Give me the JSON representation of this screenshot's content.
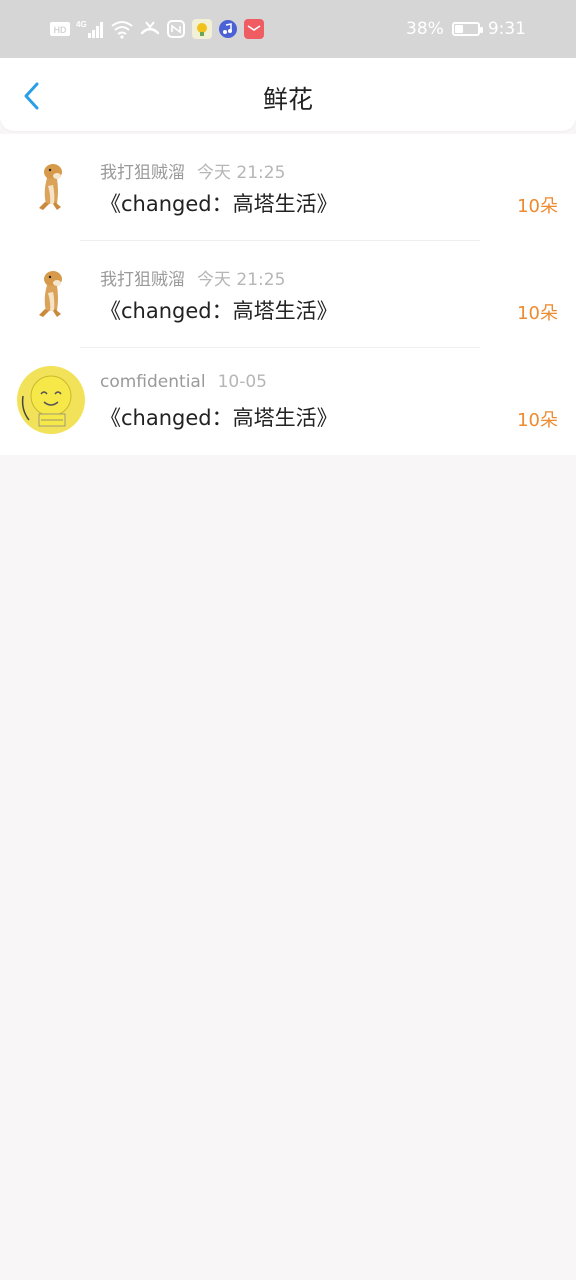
{
  "status_bar": {
    "icons": [
      "hd-icon",
      "signal-4g-icon",
      "wifi-icon",
      "missed-call-icon",
      "nfc-icon",
      "app-notification-icon",
      "music-app-icon",
      "mail-app-icon"
    ],
    "hd_label": "HD",
    "net_label": "4G",
    "battery_percent": "38%",
    "battery_level": 0.38,
    "time": "9:31"
  },
  "header": {
    "title": "鲜花"
  },
  "colors": {
    "accent_blue": "#2a9fe8",
    "count_orange": "#ee8a2f",
    "name_gray": "#9a9a9a",
    "time_gray": "#b6b6b6"
  },
  "rows": [
    {
      "name": "我打狙贼溜",
      "time": "今天 21:25",
      "message": "《changed：高塔生活》",
      "count": "10朵",
      "avatar": "shiba-dog-avatar"
    },
    {
      "name": "我打狙贼溜",
      "time": "今天 21:25",
      "message": "《changed：高塔生活》",
      "count": "10朵",
      "avatar": "shiba-dog-avatar"
    },
    {
      "name": "comfidential",
      "time": "10-05",
      "message": "《changed：高塔生活》",
      "count": "10朵",
      "avatar": "yellow-blob-avatar"
    }
  ]
}
